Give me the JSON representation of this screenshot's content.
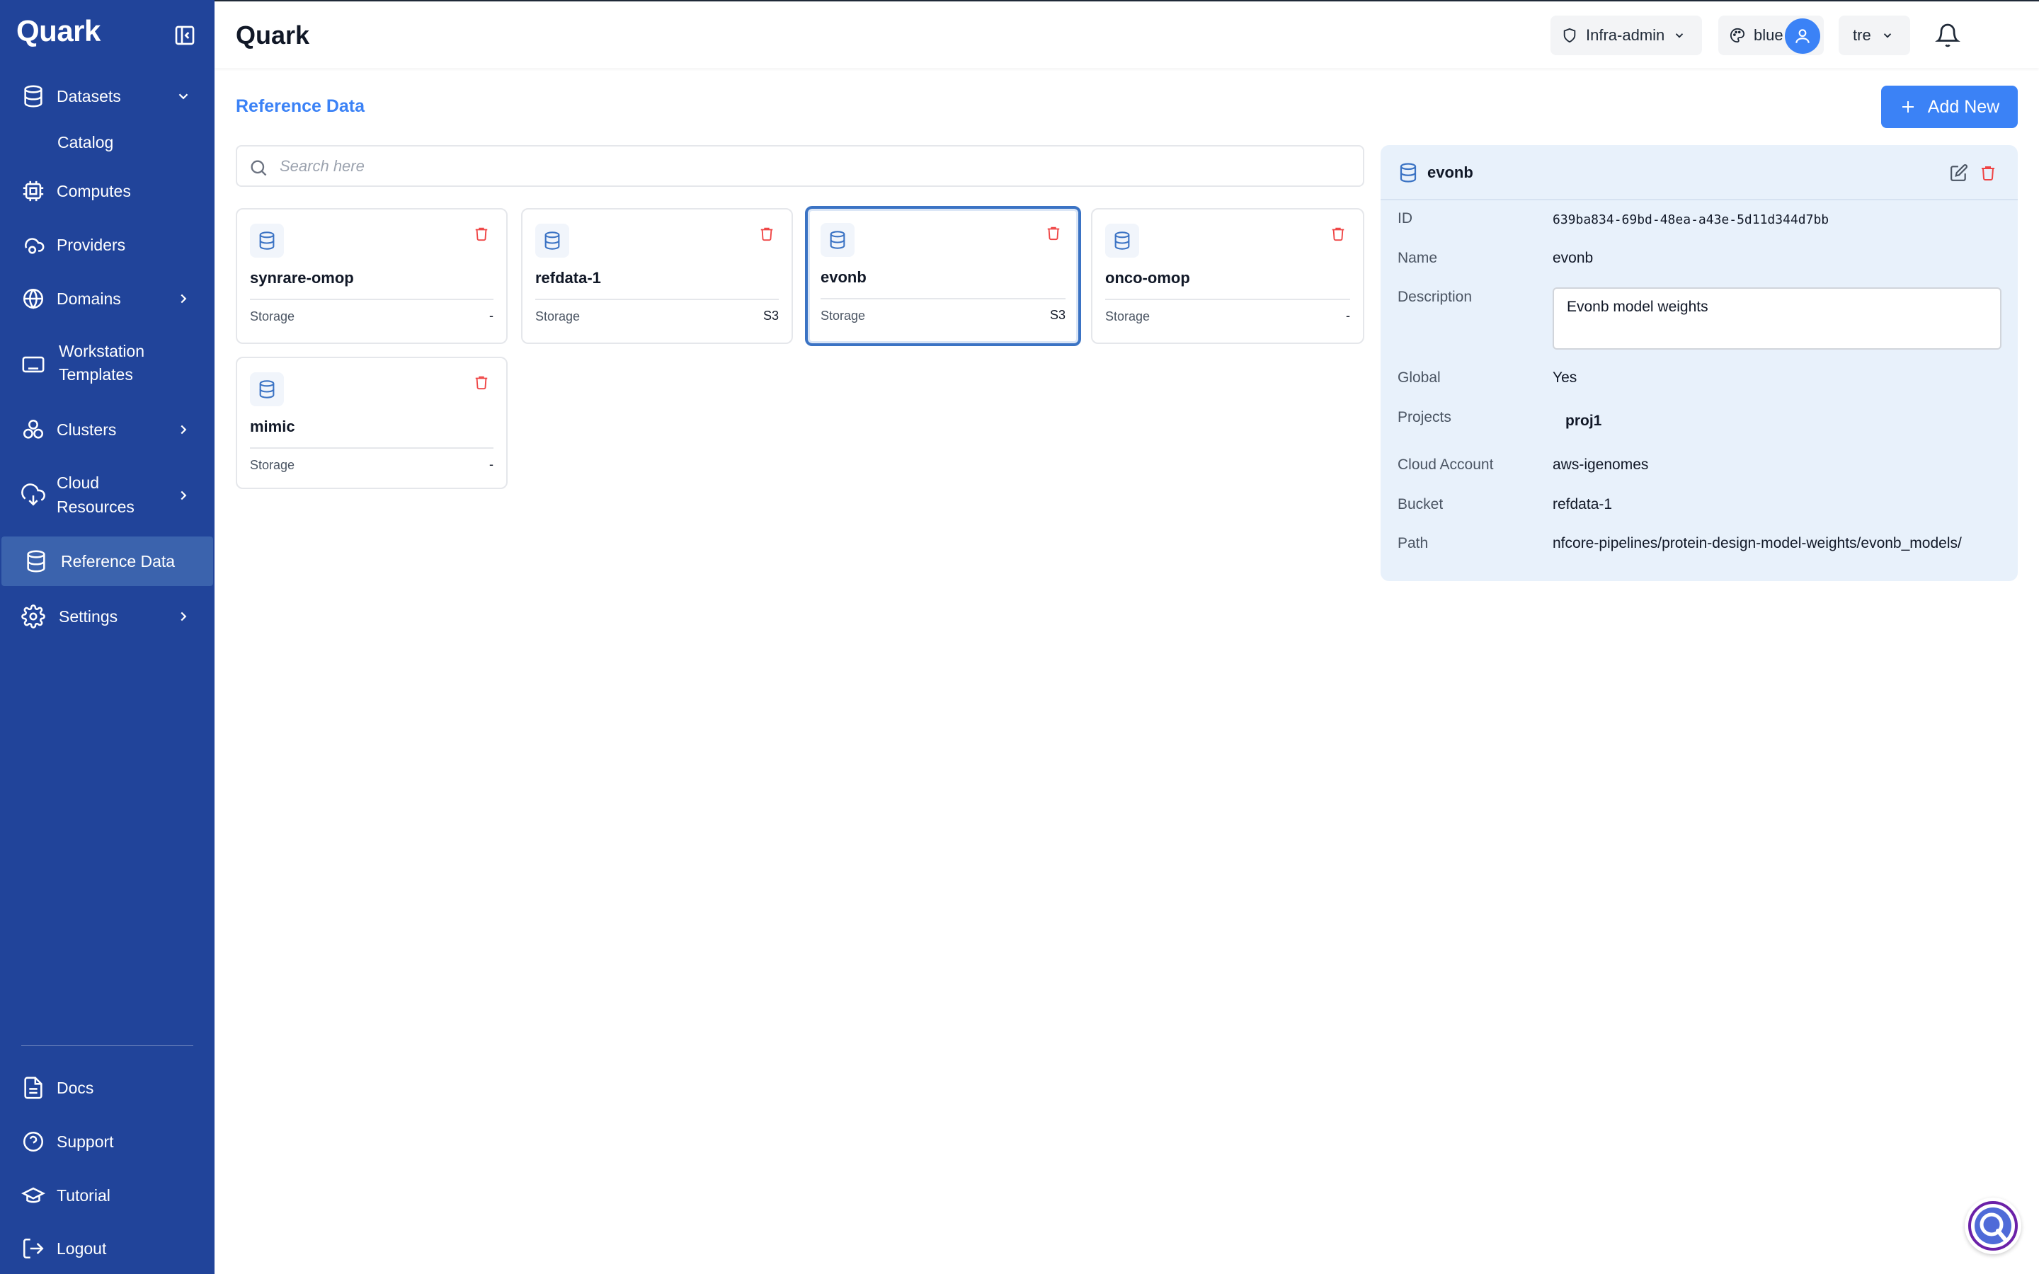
{
  "app": {
    "name": "Quark"
  },
  "sidebar": {
    "datasets": {
      "label": "Datasets",
      "sub": [
        "Catalog"
      ]
    },
    "items": [
      {
        "label": "Computes"
      },
      {
        "label": "Providers"
      },
      {
        "label": "Domains"
      },
      {
        "label": "Workstation",
        "label2": "Templates"
      },
      {
        "label": "Clusters"
      },
      {
        "label": "Cloud",
        "label2": "Resources"
      },
      {
        "label": "Reference Data"
      },
      {
        "label": "Settings"
      }
    ],
    "bottom": [
      {
        "label": "Docs"
      },
      {
        "label": "Support"
      },
      {
        "label": "Tutorial"
      },
      {
        "label": "Logout"
      }
    ]
  },
  "header": {
    "title": "Quark",
    "role": "Infra-admin",
    "theme": "blue",
    "tenant": "tre"
  },
  "page": {
    "title": "Reference Data",
    "add_label": "Add New",
    "search_placeholder": "Search here",
    "search_value": ""
  },
  "cards": [
    {
      "name": "synrare-omop",
      "label": "Storage",
      "value": "-"
    },
    {
      "name": "refdata-1",
      "label": "Storage",
      "value": "S3"
    },
    {
      "name": "evonb",
      "label": "Storage",
      "value": "S3"
    },
    {
      "name": "onco-omop",
      "label": "Storage",
      "value": "-"
    },
    {
      "name": "mimic",
      "label": "Storage",
      "value": "-"
    }
  ],
  "selected_card": "evonb",
  "detail": {
    "title": "evonb",
    "fields": {
      "id_label": "ID",
      "id": "639ba834-69bd-48ea-a43e-5d11d344d7bb",
      "name_label": "Name",
      "name": "evonb",
      "description_label": "Description",
      "description": "Evonb model weights",
      "global_label": "Global",
      "global": "Yes",
      "projects_label": "Projects",
      "projects": [
        "proj1"
      ],
      "cloud_label": "Cloud Account",
      "cloud": "aws-igenomes",
      "bucket_label": "Bucket",
      "bucket": "refdata-1",
      "path_label": "Path",
      "path": "nfcore-pipelines/protein-design-model-weights/evonb_models/"
    }
  },
  "colors": {
    "sidebar_bg": "#21449a",
    "sidebar_active": "#3b63ad",
    "accent": "#3b82f6",
    "danger": "#ef4444",
    "detail_bg": "#e8f1fb"
  },
  "icons": {
    "datasets": "database-icon",
    "computes": "cpu-icon",
    "providers": "cloud-cog-icon",
    "domains": "globe-icon",
    "workstation": "keyboard-icon",
    "clusters": "cluster-icon",
    "cloud": "cloud-download-icon",
    "reference": "database-icon",
    "settings": "gear-icon",
    "docs": "document-icon",
    "support": "help-circle-icon",
    "tutorial": "graduation-cap-icon",
    "logout": "logout-icon"
  }
}
